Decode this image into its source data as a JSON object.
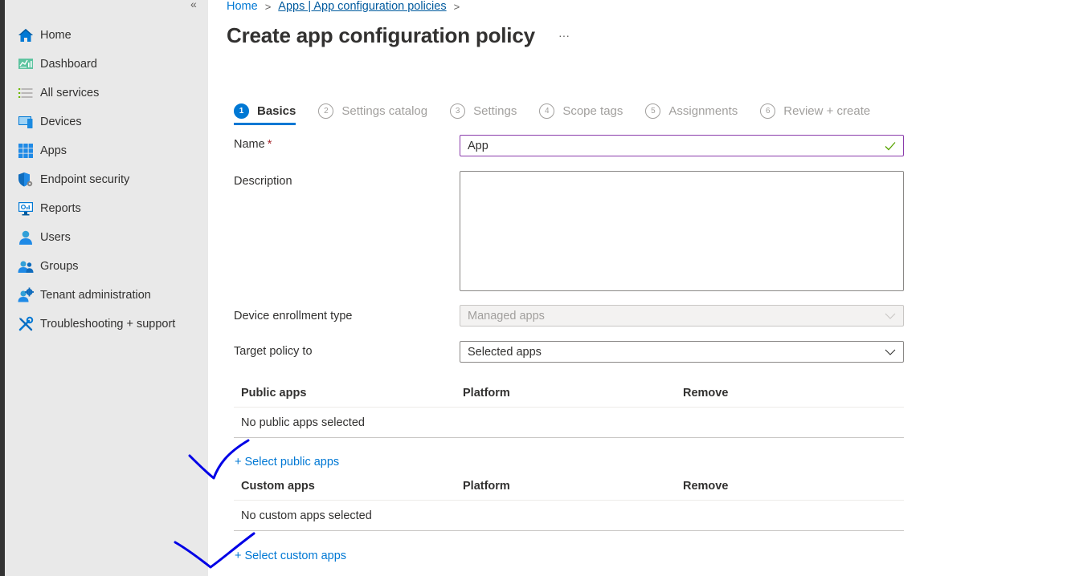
{
  "sidebar": {
    "collapse_label": "«",
    "items": [
      {
        "label": "Home",
        "icon": "home-icon"
      },
      {
        "label": "Dashboard",
        "icon": "dashboard-icon"
      },
      {
        "label": "All services",
        "icon": "all-services-icon"
      },
      {
        "label": "Devices",
        "icon": "devices-icon"
      },
      {
        "label": "Apps",
        "icon": "apps-icon"
      },
      {
        "label": "Endpoint security",
        "icon": "endpoint-security-icon"
      },
      {
        "label": "Reports",
        "icon": "reports-icon"
      },
      {
        "label": "Users",
        "icon": "users-icon"
      },
      {
        "label": "Groups",
        "icon": "groups-icon"
      },
      {
        "label": "Tenant administration",
        "icon": "tenant-admin-icon"
      },
      {
        "label": "Troubleshooting + support",
        "icon": "troubleshooting-icon"
      }
    ]
  },
  "breadcrumb": {
    "items": [
      "Home",
      "Apps | App configuration policies"
    ],
    "separator": ">"
  },
  "page": {
    "title": "Create app configuration policy",
    "more_label": "···"
  },
  "wizard": {
    "active_step": 1,
    "steps": [
      {
        "num": "1",
        "label": "Basics"
      },
      {
        "num": "2",
        "label": "Settings catalog"
      },
      {
        "num": "3",
        "label": "Settings"
      },
      {
        "num": "4",
        "label": "Scope tags"
      },
      {
        "num": "5",
        "label": "Assignments"
      },
      {
        "num": "6",
        "label": "Review + create"
      }
    ]
  },
  "form": {
    "name_label": "Name",
    "required_mark": "*",
    "name_value": "App",
    "description_label": "Description",
    "description_value": "",
    "enrollment_label": "Device enrollment type",
    "enrollment_value": "Managed apps",
    "target_label": "Target policy to",
    "target_value": "Selected apps"
  },
  "public_apps": {
    "columns": [
      "Public apps",
      "Platform",
      "Remove"
    ],
    "empty_text": "No public apps selected",
    "add_link": "+ Select public apps"
  },
  "custom_apps": {
    "columns": [
      "Custom apps",
      "Platform",
      "Remove"
    ],
    "empty_text": "No custom apps selected",
    "add_link": "+ Select custom apps"
  },
  "colors": {
    "accent": "#0078d4",
    "focus_border": "#8a3bab",
    "valid_check": "#57a300",
    "annotation_ink": "#0000e6",
    "sidebar_bg": "#e9e9e9"
  }
}
